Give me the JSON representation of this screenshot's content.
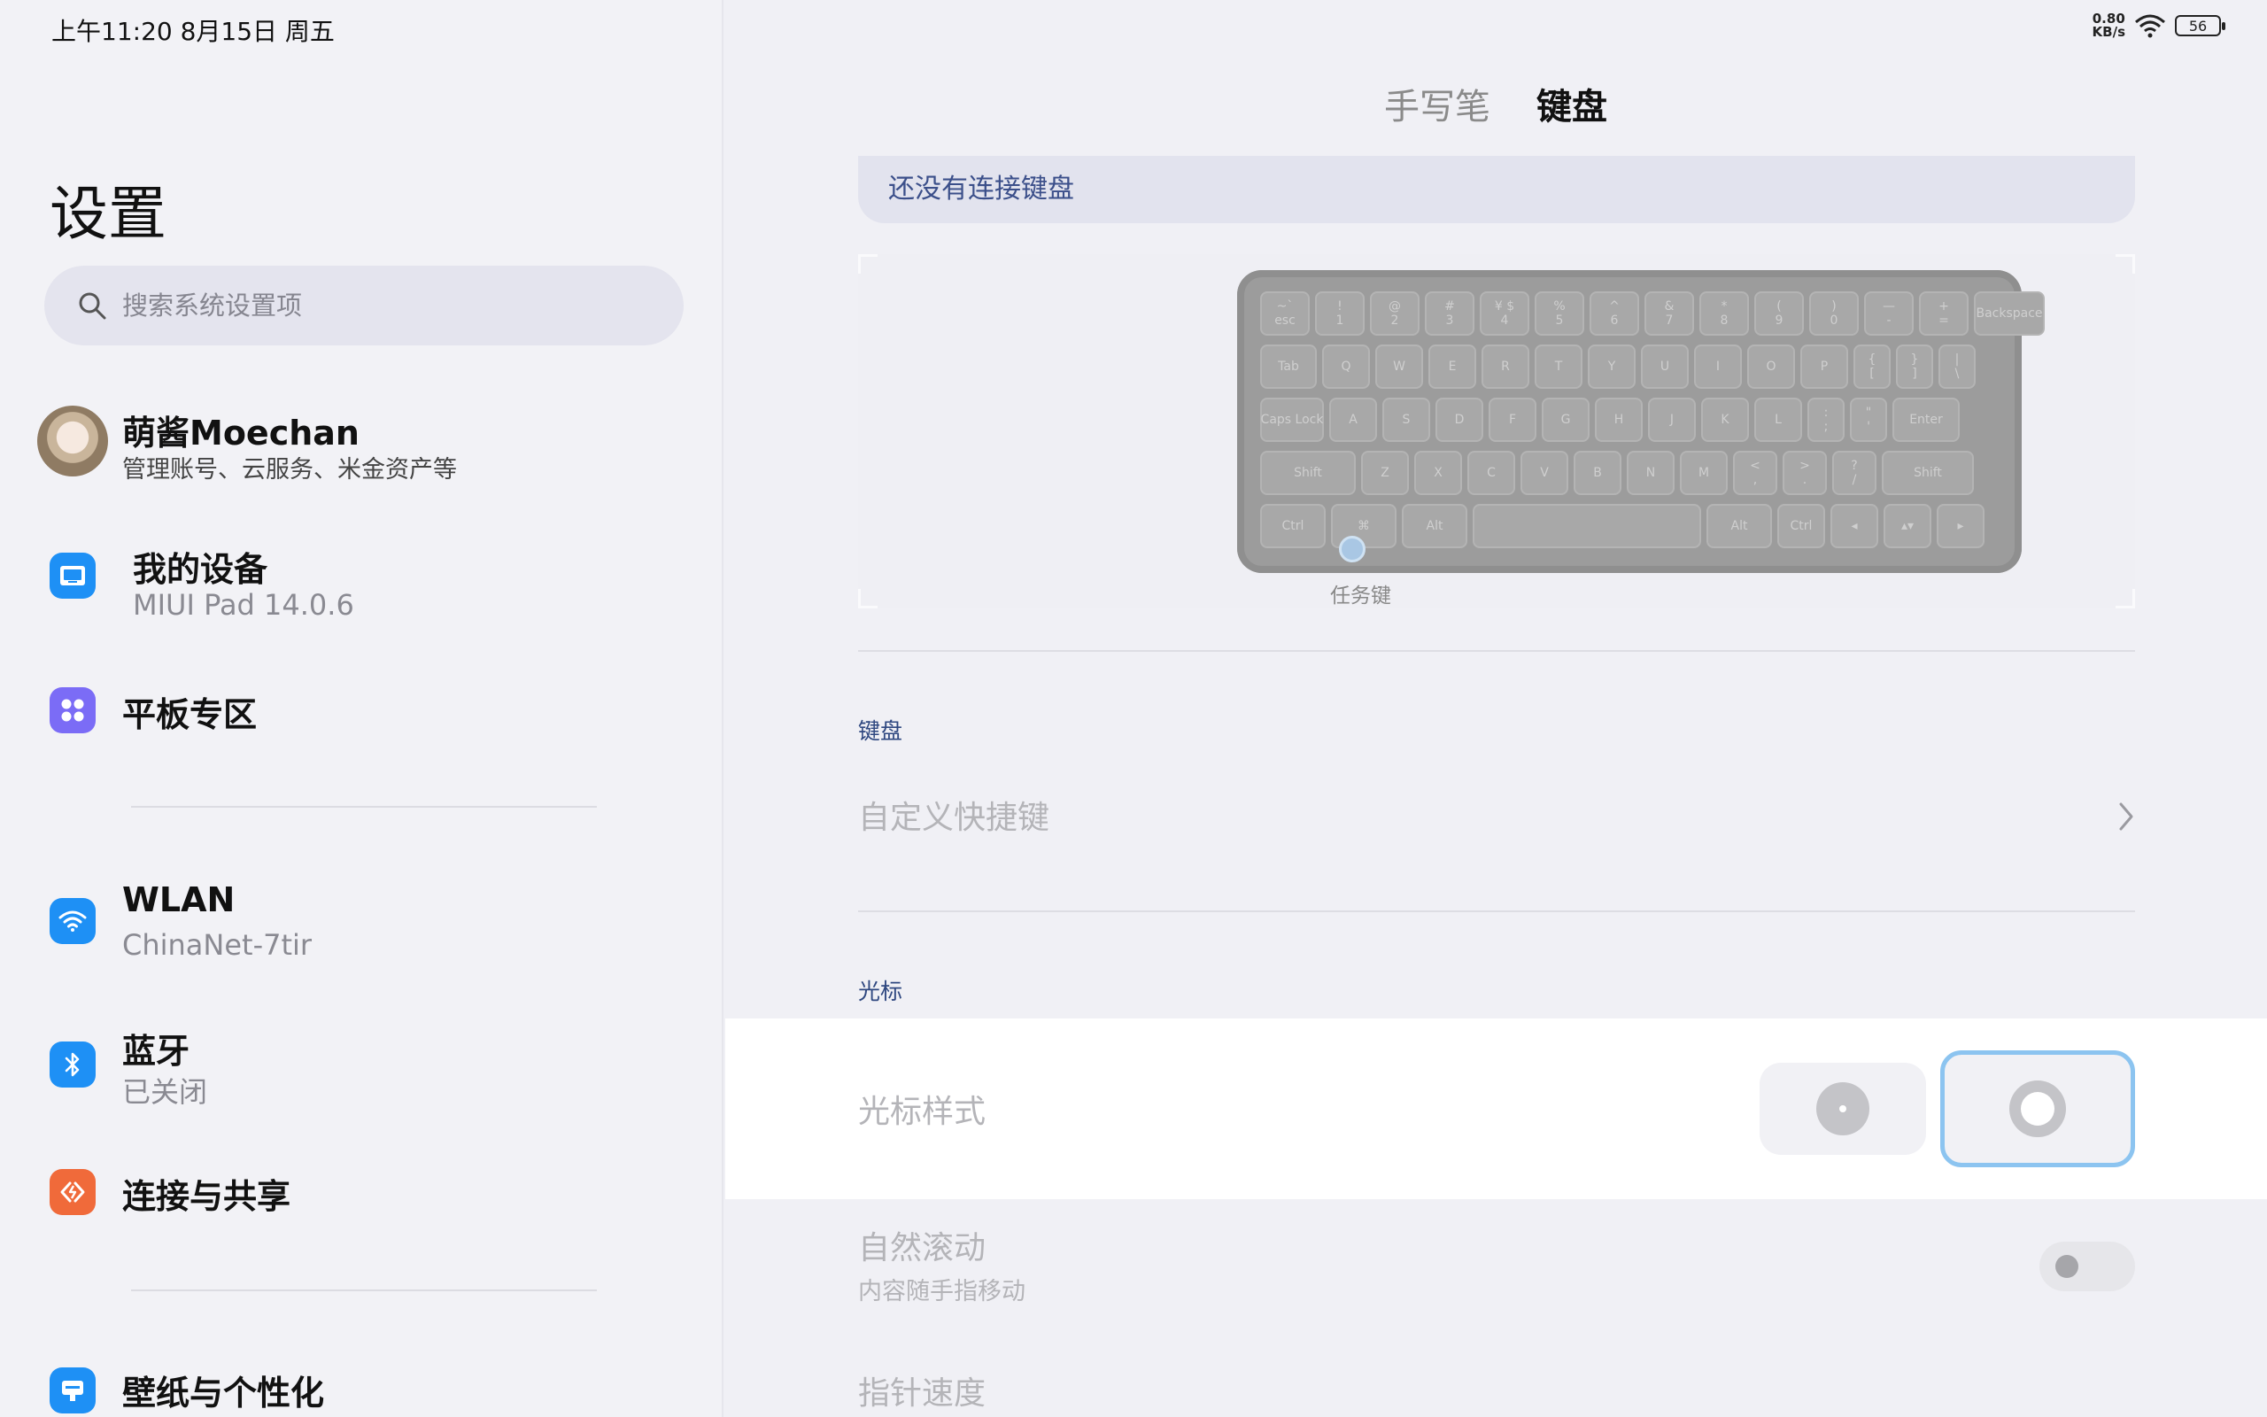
{
  "status_bar": {
    "time_date": "上午11:20 8月15日 周五",
    "net_speed_value": "0.80",
    "net_speed_unit": "KB/s",
    "battery": "56"
  },
  "sidebar": {
    "title": "设置",
    "search_placeholder": "搜索系统设置项",
    "account": {
      "name": "萌酱Moechan",
      "subtitle": "管理账号、云服务、米金资产等"
    },
    "items": [
      {
        "label": "我的设备",
        "subtitle": "MIUI Pad 14.0.6",
        "icon": "tablet-icon",
        "color": "#1e90f5"
      },
      {
        "label": "平板专区",
        "subtitle": "",
        "icon": "apps-grid-icon",
        "color": "#7b6cf6"
      },
      {
        "label": "WLAN",
        "subtitle": "ChinaNet-7tir",
        "icon": "wifi-icon",
        "color": "#1e90f5"
      },
      {
        "label": "蓝牙",
        "subtitle": "已关闭",
        "icon": "bluetooth-icon",
        "color": "#1e90f5"
      },
      {
        "label": "连接与共享",
        "subtitle": "",
        "icon": "share-icon",
        "color": "#f06a3a"
      },
      {
        "label": "壁纸与个性化",
        "subtitle": "",
        "icon": "wallpaper-icon",
        "color": "#1e90f5"
      }
    ]
  },
  "main": {
    "tabs": [
      {
        "label": "手写笔",
        "active": false
      },
      {
        "label": "键盘",
        "active": true
      }
    ],
    "banner": "还没有连接键盘",
    "task_key_label": "任务键",
    "keyboard_section": {
      "label": "键盘",
      "custom_shortcuts": "自定义快捷键"
    },
    "cursor_section": {
      "label": "光标",
      "cursor_style": "光标样式",
      "selected_option": 2
    },
    "natural_scroll": {
      "title": "自然滚动",
      "subtitle": "内容随手指移动",
      "enabled": false
    },
    "pointer_speed": "指针速度"
  },
  "keyboard_keys": {
    "row1": [
      "~`\nesc",
      "!\n1",
      "@\n2",
      "#\n3",
      "¥ $\n4",
      "%\n5",
      "^\n6",
      "&\n7",
      "*\n8",
      "(\n9",
      ")\n0",
      "—\n-",
      "+\n=",
      "Backspace"
    ],
    "row2": [
      "Tab",
      "Q",
      "W",
      "E",
      "R",
      "T",
      "Y",
      "U",
      "I",
      "O",
      "P",
      "{\n[",
      "}\n]",
      "|\n\\"
    ],
    "row3": [
      "Caps Lock",
      "A",
      "S",
      "D",
      "F",
      "G",
      "H",
      "J",
      "K",
      "L",
      ":\n;",
      "\"\n'",
      "Enter"
    ],
    "row4": [
      "Shift",
      "Z",
      "X",
      "C",
      "V",
      "B",
      "N",
      "M",
      "<\n,",
      ">\n.",
      "?\n/",
      "Shift"
    ],
    "row5": [
      "Ctrl",
      "⌘",
      "Alt",
      "",
      "Alt",
      "Ctrl",
      "◂",
      "▴▾",
      "▸"
    ]
  },
  "colors": {
    "accent": "#1e90f5",
    "section_label": "#2e4780",
    "selected_border": "#8cc4f0"
  }
}
